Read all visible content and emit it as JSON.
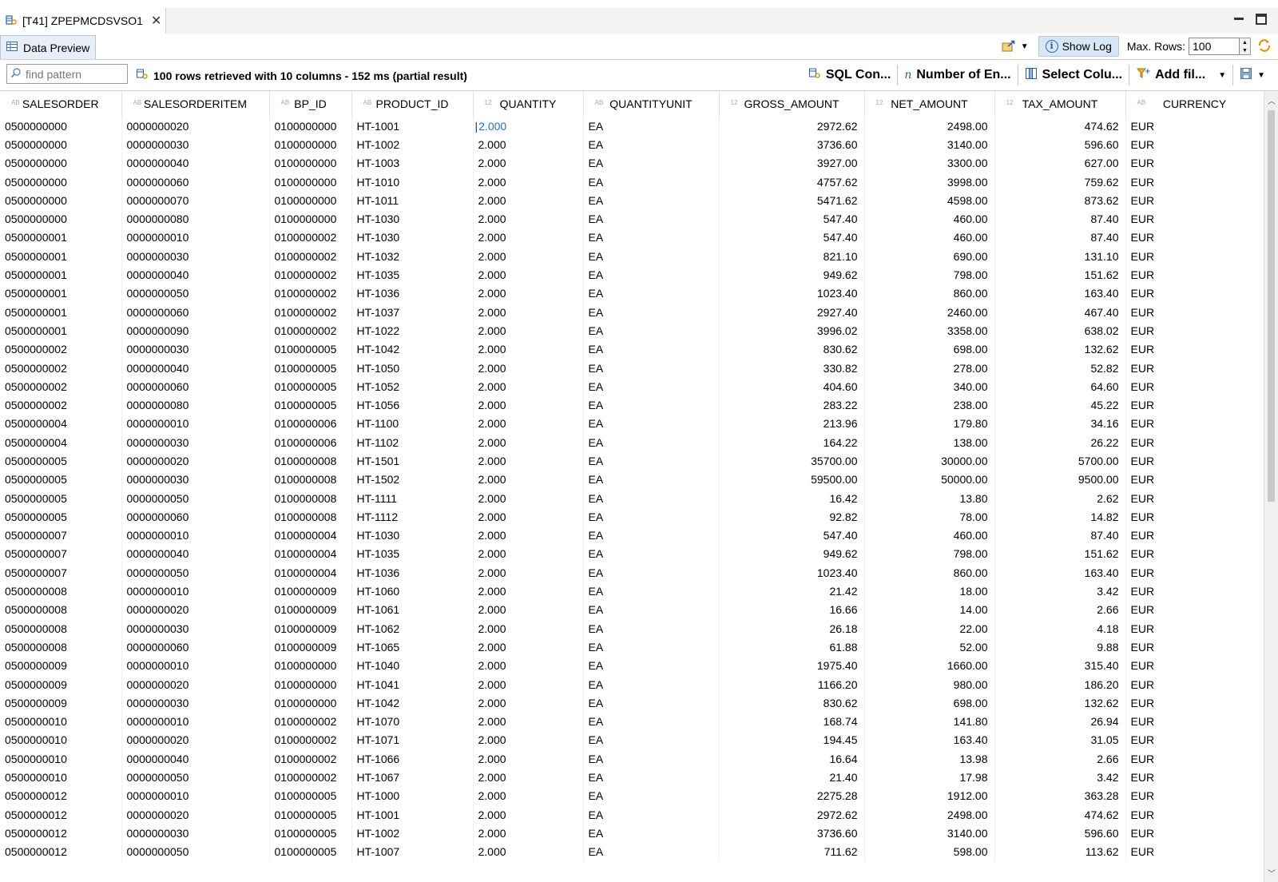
{
  "editor_tab": {
    "title": "[T41] ZPEPMCDSVSO1"
  },
  "view_tab": {
    "title": "Data Preview"
  },
  "view_tools": {
    "show_log": "Show Log",
    "max_rows_label": "Max. Rows:",
    "max_rows_value": "100"
  },
  "toolbar": {
    "find_placeholder": "find pattern",
    "status": "100 rows retrieved with 10 columns - 152 ms (partial result)",
    "sql_console": "SQL Con...",
    "number_of_entries": "Number of En...",
    "select_columns": "Select Colu...",
    "add_filter": "Add fil..."
  },
  "icons": {
    "editor_tab": "data-preview-icon",
    "view_tab": "table-icon",
    "find": "search-icon",
    "status": "sql-query-icon",
    "sql_console": "sql-console-icon",
    "number_of_entries": "count-icon",
    "select_columns": "columns-icon",
    "add_filter": "filter-icon",
    "save": "save-icon",
    "refresh": "refresh-icon",
    "export": "export-icon"
  },
  "columns": [
    {
      "label": "SALESORDER",
      "type": "AB"
    },
    {
      "label": "SALESORDERITEM",
      "type": "AB"
    },
    {
      "label": "BP_ID",
      "type": "AB"
    },
    {
      "label": "PRODUCT_ID",
      "type": "AB"
    },
    {
      "label": "QUANTITY",
      "type": "12"
    },
    {
      "label": "QUANTITYUNIT",
      "type": "AB"
    },
    {
      "label": "GROSS_AMOUNT",
      "type": "12"
    },
    {
      "label": "NET_AMOUNT",
      "type": "12"
    },
    {
      "label": "TAX_AMOUNT",
      "type": "12"
    },
    {
      "label": "CURRENCY",
      "type": "AB"
    }
  ],
  "rows": [
    [
      "0500000000",
      "0000000020",
      "0100000000",
      "HT-1001",
      "2.000",
      "EA",
      "2972.62",
      "2498.00",
      "474.62",
      "EUR"
    ],
    [
      "0500000000",
      "0000000030",
      "0100000000",
      "HT-1002",
      "2.000",
      "EA",
      "3736.60",
      "3140.00",
      "596.60",
      "EUR"
    ],
    [
      "0500000000",
      "0000000040",
      "0100000000",
      "HT-1003",
      "2.000",
      "EA",
      "3927.00",
      "3300.00",
      "627.00",
      "EUR"
    ],
    [
      "0500000000",
      "0000000060",
      "0100000000",
      "HT-1010",
      "2.000",
      "EA",
      "4757.62",
      "3998.00",
      "759.62",
      "EUR"
    ],
    [
      "0500000000",
      "0000000070",
      "0100000000",
      "HT-1011",
      "2.000",
      "EA",
      "5471.62",
      "4598.00",
      "873.62",
      "EUR"
    ],
    [
      "0500000000",
      "0000000080",
      "0100000000",
      "HT-1030",
      "2.000",
      "EA",
      "547.40",
      "460.00",
      "87.40",
      "EUR"
    ],
    [
      "0500000001",
      "0000000010",
      "0100000002",
      "HT-1030",
      "2.000",
      "EA",
      "547.40",
      "460.00",
      "87.40",
      "EUR"
    ],
    [
      "0500000001",
      "0000000030",
      "0100000002",
      "HT-1032",
      "2.000",
      "EA",
      "821.10",
      "690.00",
      "131.10",
      "EUR"
    ],
    [
      "0500000001",
      "0000000040",
      "0100000002",
      "HT-1035",
      "2.000",
      "EA",
      "949.62",
      "798.00",
      "151.62",
      "EUR"
    ],
    [
      "0500000001",
      "0000000050",
      "0100000002",
      "HT-1036",
      "2.000",
      "EA",
      "1023.40",
      "860.00",
      "163.40",
      "EUR"
    ],
    [
      "0500000001",
      "0000000060",
      "0100000002",
      "HT-1037",
      "2.000",
      "EA",
      "2927.40",
      "2460.00",
      "467.40",
      "EUR"
    ],
    [
      "0500000001",
      "0000000090",
      "0100000002",
      "HT-1022",
      "2.000",
      "EA",
      "3996.02",
      "3358.00",
      "638.02",
      "EUR"
    ],
    [
      "0500000002",
      "0000000030",
      "0100000005",
      "HT-1042",
      "2.000",
      "EA",
      "830.62",
      "698.00",
      "132.62",
      "EUR"
    ],
    [
      "0500000002",
      "0000000040",
      "0100000005",
      "HT-1050",
      "2.000",
      "EA",
      "330.82",
      "278.00",
      "52.82",
      "EUR"
    ],
    [
      "0500000002",
      "0000000060",
      "0100000005",
      "HT-1052",
      "2.000",
      "EA",
      "404.60",
      "340.00",
      "64.60",
      "EUR"
    ],
    [
      "0500000002",
      "0000000080",
      "0100000005",
      "HT-1056",
      "2.000",
      "EA",
      "283.22",
      "238.00",
      "45.22",
      "EUR"
    ],
    [
      "0500000004",
      "0000000010",
      "0100000006",
      "HT-1100",
      "2.000",
      "EA",
      "213.96",
      "179.80",
      "34.16",
      "EUR"
    ],
    [
      "0500000004",
      "0000000030",
      "0100000006",
      "HT-1102",
      "2.000",
      "EA",
      "164.22",
      "138.00",
      "26.22",
      "EUR"
    ],
    [
      "0500000005",
      "0000000020",
      "0100000008",
      "HT-1501",
      "2.000",
      "EA",
      "35700.00",
      "30000.00",
      "5700.00",
      "EUR"
    ],
    [
      "0500000005",
      "0000000030",
      "0100000008",
      "HT-1502",
      "2.000",
      "EA",
      "59500.00",
      "50000.00",
      "9500.00",
      "EUR"
    ],
    [
      "0500000005",
      "0000000050",
      "0100000008",
      "HT-1111",
      "2.000",
      "EA",
      "16.42",
      "13.80",
      "2.62",
      "EUR"
    ],
    [
      "0500000005",
      "0000000060",
      "0100000008",
      "HT-1112",
      "2.000",
      "EA",
      "92.82",
      "78.00",
      "14.82",
      "EUR"
    ],
    [
      "0500000007",
      "0000000010",
      "0100000004",
      "HT-1030",
      "2.000",
      "EA",
      "547.40",
      "460.00",
      "87.40",
      "EUR"
    ],
    [
      "0500000007",
      "0000000040",
      "0100000004",
      "HT-1035",
      "2.000",
      "EA",
      "949.62",
      "798.00",
      "151.62",
      "EUR"
    ],
    [
      "0500000007",
      "0000000050",
      "0100000004",
      "HT-1036",
      "2.000",
      "EA",
      "1023.40",
      "860.00",
      "163.40",
      "EUR"
    ],
    [
      "0500000008",
      "0000000010",
      "0100000009",
      "HT-1060",
      "2.000",
      "EA",
      "21.42",
      "18.00",
      "3.42",
      "EUR"
    ],
    [
      "0500000008",
      "0000000020",
      "0100000009",
      "HT-1061",
      "2.000",
      "EA",
      "16.66",
      "14.00",
      "2.66",
      "EUR"
    ],
    [
      "0500000008",
      "0000000030",
      "0100000009",
      "HT-1062",
      "2.000",
      "EA",
      "26.18",
      "22.00",
      "4.18",
      "EUR"
    ],
    [
      "0500000008",
      "0000000060",
      "0100000009",
      "HT-1065",
      "2.000",
      "EA",
      "61.88",
      "52.00",
      "9.88",
      "EUR"
    ],
    [
      "0500000009",
      "0000000010",
      "0100000000",
      "HT-1040",
      "2.000",
      "EA",
      "1975.40",
      "1660.00",
      "315.40",
      "EUR"
    ],
    [
      "0500000009",
      "0000000020",
      "0100000000",
      "HT-1041",
      "2.000",
      "EA",
      "1166.20",
      "980.00",
      "186.20",
      "EUR"
    ],
    [
      "0500000009",
      "0000000030",
      "0100000000",
      "HT-1042",
      "2.000",
      "EA",
      "830.62",
      "698.00",
      "132.62",
      "EUR"
    ],
    [
      "0500000010",
      "0000000010",
      "0100000002",
      "HT-1070",
      "2.000",
      "EA",
      "168.74",
      "141.80",
      "26.94",
      "EUR"
    ],
    [
      "0500000010",
      "0000000020",
      "0100000002",
      "HT-1071",
      "2.000",
      "EA",
      "194.45",
      "163.40",
      "31.05",
      "EUR"
    ],
    [
      "0500000010",
      "0000000040",
      "0100000002",
      "HT-1066",
      "2.000",
      "EA",
      "16.64",
      "13.98",
      "2.66",
      "EUR"
    ],
    [
      "0500000010",
      "0000000050",
      "0100000002",
      "HT-1067",
      "2.000",
      "EA",
      "21.40",
      "17.98",
      "3.42",
      "EUR"
    ],
    [
      "0500000012",
      "0000000010",
      "0100000005",
      "HT-1000",
      "2.000",
      "EA",
      "2275.28",
      "1912.00",
      "363.28",
      "EUR"
    ],
    [
      "0500000012",
      "0000000020",
      "0100000005",
      "HT-1001",
      "2.000",
      "EA",
      "2972.62",
      "2498.00",
      "474.62",
      "EUR"
    ],
    [
      "0500000012",
      "0000000030",
      "0100000005",
      "HT-1002",
      "2.000",
      "EA",
      "3736.60",
      "3140.00",
      "596.60",
      "EUR"
    ],
    [
      "0500000012",
      "0000000050",
      "0100000005",
      "HT-1007",
      "2.000",
      "EA",
      "711.62",
      "598.00",
      "113.62",
      "EUR"
    ]
  ]
}
